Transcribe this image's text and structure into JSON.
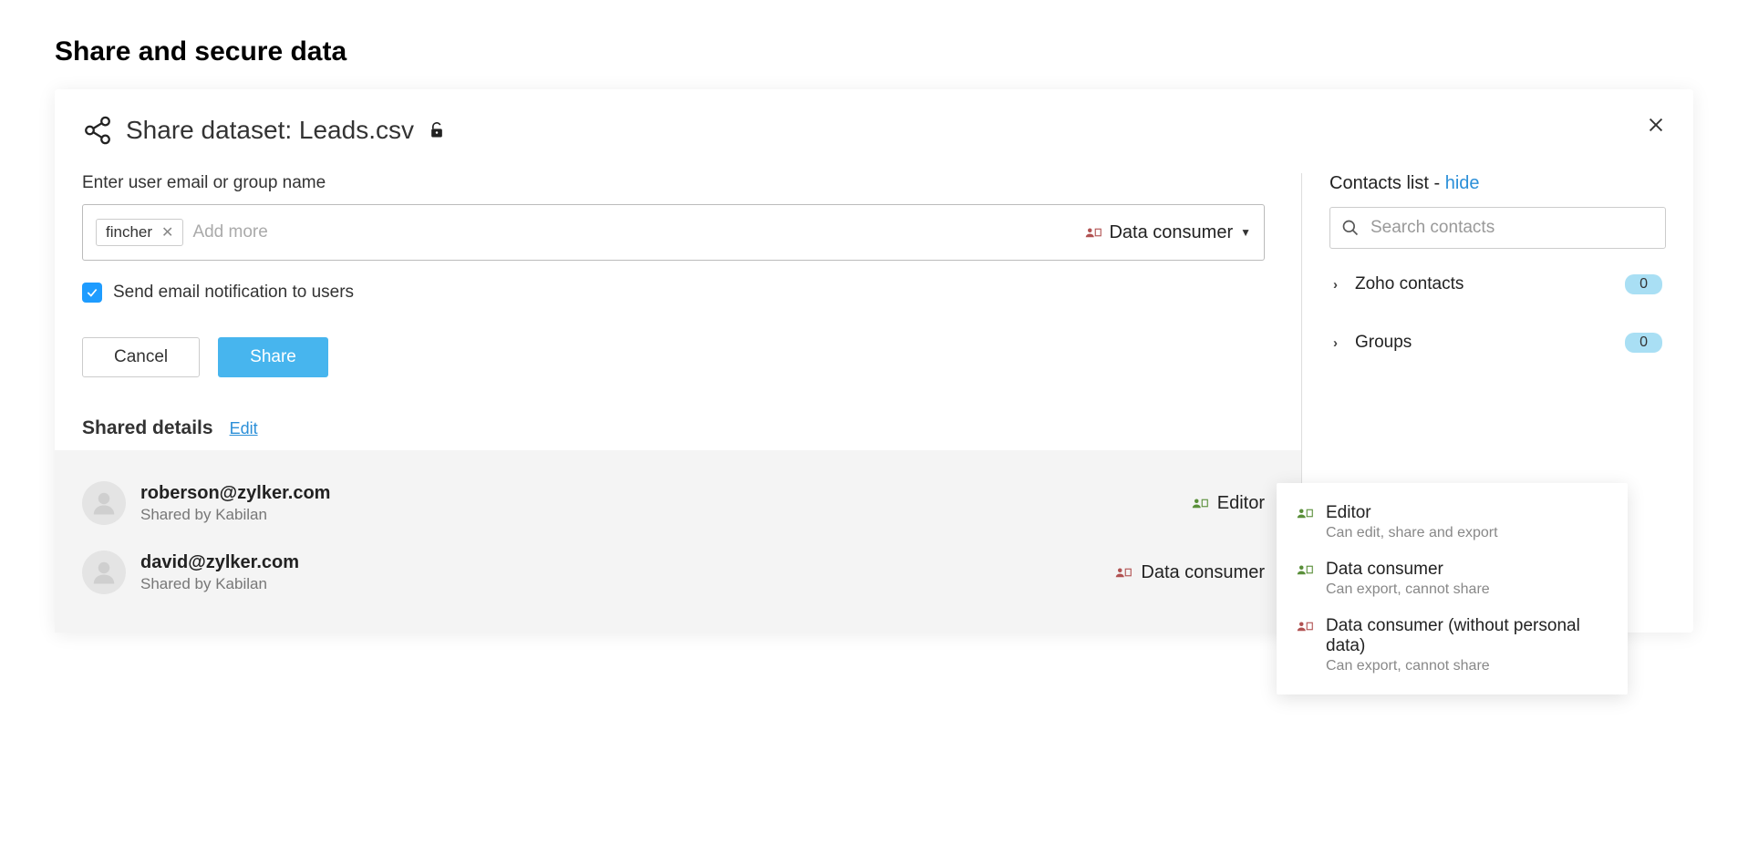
{
  "page": {
    "title": "Share and secure data"
  },
  "dialog": {
    "title": "Share dataset: Leads.csv",
    "field_label": "Enter user email or group name",
    "chip": "fincher",
    "add_more_placeholder": "Add more",
    "role_selected": "Data consumer",
    "notify_label": "Send email notification to users",
    "cancel_label": "Cancel",
    "share_label": "Share"
  },
  "shared": {
    "heading": "Shared details",
    "edit_label": "Edit",
    "rows": [
      {
        "email": "roberson@zylker.com",
        "sub": "Shared by Kabilan",
        "role": "Editor",
        "role_color": "#5a8f3a"
      },
      {
        "email": "david@zylker.com",
        "sub": "Shared by Kabilan",
        "role": "Data consumer",
        "role_color": "#b15252"
      }
    ]
  },
  "contacts": {
    "list_label": "Contacts list - ",
    "hide_label": "hide",
    "search_placeholder": "Search contacts",
    "groups": [
      {
        "name": "Zoho contacts",
        "count": "0"
      },
      {
        "name": "Groups",
        "count": "0"
      }
    ]
  },
  "role_menu": [
    {
      "title": "Editor",
      "sub": "Can edit, share and export",
      "color": "#5a8f3a"
    },
    {
      "title": "Data consumer",
      "sub": "Can export, cannot share",
      "color": "#5a8f3a"
    },
    {
      "title": "Data consumer (without personal data)",
      "sub": "Can export, cannot share",
      "color": "#b15252"
    }
  ],
  "colors": {
    "role_consumer": "#b15252"
  }
}
